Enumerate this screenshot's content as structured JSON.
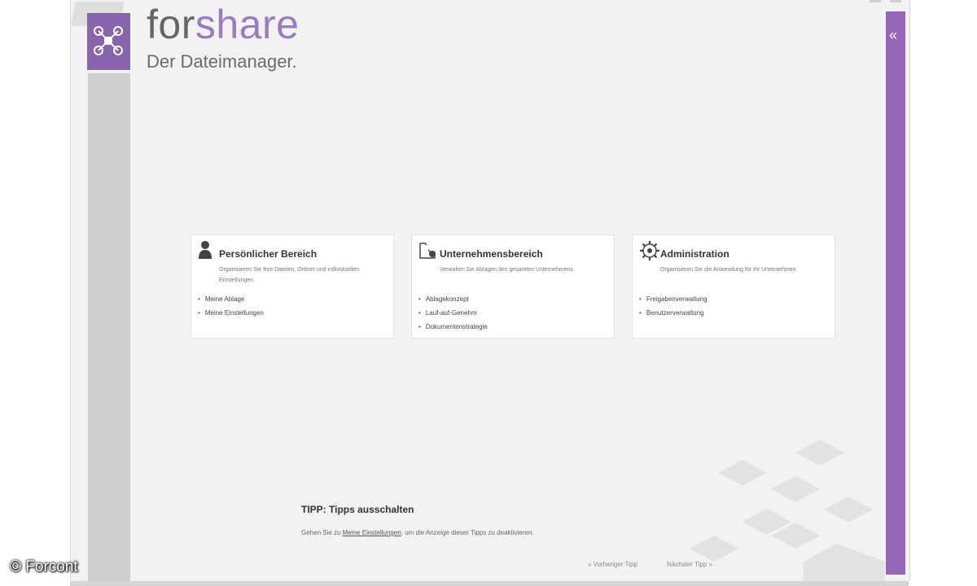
{
  "brand": {
    "name_part1": "for",
    "name_part2": "share",
    "tagline": "Der Dateimanager."
  },
  "cards": [
    {
      "title": "Persönlicher Bereich",
      "icon": "user-icon",
      "description": "Organisieren Sie Ihre Dateien, Ordner und individuellen Einstellungen.",
      "links": [
        "Meine Ablage",
        "Meine Einstellungen"
      ]
    },
    {
      "title": "Unternehmensbereich",
      "icon": "company-files-icon",
      "description": "Verwalten Sie Ablagen des gesamten Unternehmens.",
      "links": [
        "Ablagekonzept",
        "Lauf-auf-Genehm",
        "Dokumentenstrategie"
      ]
    },
    {
      "title": "Administration",
      "icon": "gear-icon",
      "description": "Organisieren Sie die Anwendung für Ihr Unternehmen.",
      "links": [
        "Freigabenverwaltung",
        "Benutzerverwaltung"
      ]
    }
  ],
  "tip": {
    "title": "TIPP: Tipps ausschalten",
    "text_before": "Gehen Sie zu",
    "link": "Meine Einstellungen",
    "text_after": ", um die Anzeige dieser Tipps zu deaktivieren."
  },
  "tip_nav": {
    "previous": "« Vorheriger Tipp",
    "next": "Nächster Tipp »"
  },
  "watermark": "© Forcont",
  "colors": {
    "accent": "#9466b5",
    "logo": "#8a63ad",
    "brand_second": "#9a7cbe"
  }
}
